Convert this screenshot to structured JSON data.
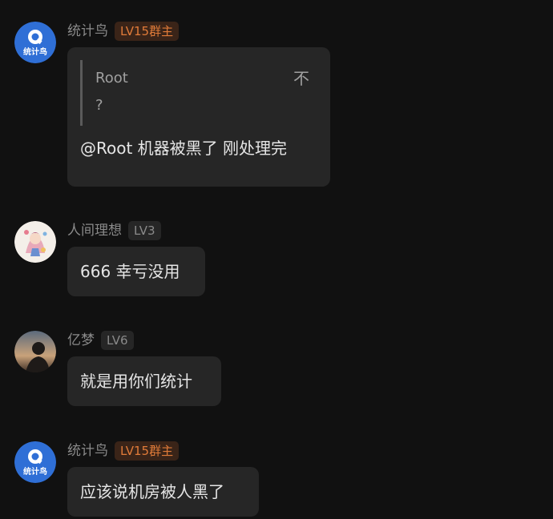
{
  "messages": [
    {
      "sender": "统计鸟",
      "level": "LV15",
      "role": "群主",
      "avatar_text": "统计鸟",
      "reply": {
        "quoted_name": "Root",
        "quoted_text": "?",
        "close_glyph": "不"
      },
      "text": "@Root 机器被黑了 刚处理完"
    },
    {
      "sender": "人间理想",
      "level": "LV3",
      "text": "666 幸亏没用"
    },
    {
      "sender": "亿梦",
      "level": "LV6",
      "text": "就是用你们统计"
    },
    {
      "sender": "统计鸟",
      "level": "LV15",
      "role": "群主",
      "avatar_text": "统计鸟",
      "text": "应该说机房被人黑了"
    }
  ],
  "colors": {
    "background": "#111111",
    "bubble": "#262626",
    "owner_badge_bg": "#3a2418",
    "owner_badge_text": "#e07b39",
    "avatar_blue": "#2f6fd6"
  },
  "icons": {
    "bot_avatar": "stat-bird-logo-icon",
    "user_avatar_1": "anime-girl-avatar-icon",
    "user_avatar_2": "silhouette-sunset-avatar-icon"
  }
}
